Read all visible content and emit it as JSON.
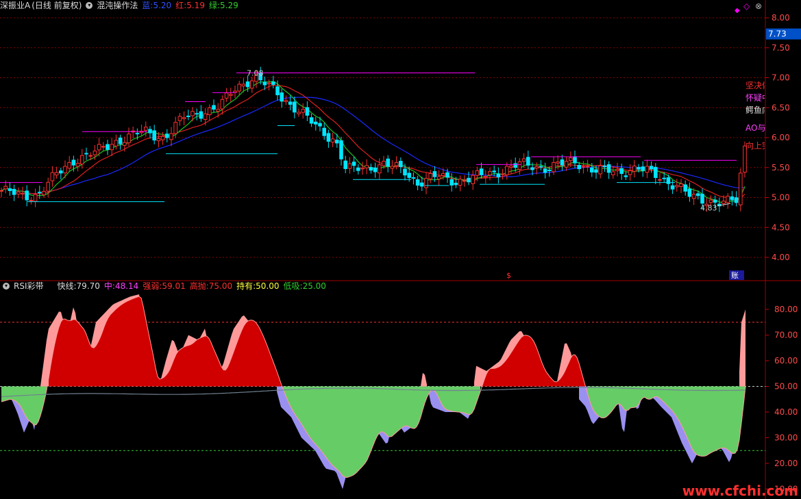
{
  "main_header": {
    "stock": "深振业A",
    "period": "(日线 前复权)",
    "formula": "混沌操作法",
    "blue_label": "蓝:",
    "blue_value": "5.20",
    "red_label": "红:",
    "red_value": "5.19",
    "green_label": "绿:",
    "green_value": "5.29"
  },
  "sub_header": {
    "name": "RSI彩带",
    "fast_label": "快线:",
    "fast_value": "79.70",
    "mid_label": "中:",
    "mid_value": "48.14",
    "strong_label": "强弱:",
    "strong_value": "59.01",
    "high_label": "高抛:",
    "high_value": "75.00",
    "hold_label": "持有:",
    "hold_value": "50.00",
    "low_label": "低吸:",
    "low_value": "25.00"
  },
  "price_axis": [
    "8.00",
    "7.50",
    "7.00",
    "6.50",
    "6.00",
    "5.50",
    "5.00",
    "4.50",
    "4.00"
  ],
  "current_price": "7.73",
  "rsi_axis": [
    "80.00",
    "70.00",
    "60.00",
    "50.00",
    "40.00",
    "30.00",
    "20.00",
    "10.00"
  ],
  "annotations": [
    {
      "text": "坚决做多",
      "color": "#ff3030"
    },
    {
      "text": "怀疑中",
      "color": "#ff40ff"
    },
    {
      "text": "鳄鱼向上",
      "color": "#dddddd"
    },
    {
      "text": "AO与AC",
      "color": "#ff40ff"
    },
    {
      "text": "向上突破",
      "color": "#ff3030"
    }
  ],
  "price_marks": {
    "high": "7.08",
    "low": "4.83"
  },
  "bottom_markers": {
    "s": "$",
    "b": "账"
  },
  "watermark": "www.cfchi.com",
  "colors": {
    "blue": "#1a2aff",
    "red": "#ff3030",
    "green": "#30d030",
    "cyan": "#00e5ff",
    "magenta": "#ff00ff",
    "grid": "#8a0000"
  }
}
